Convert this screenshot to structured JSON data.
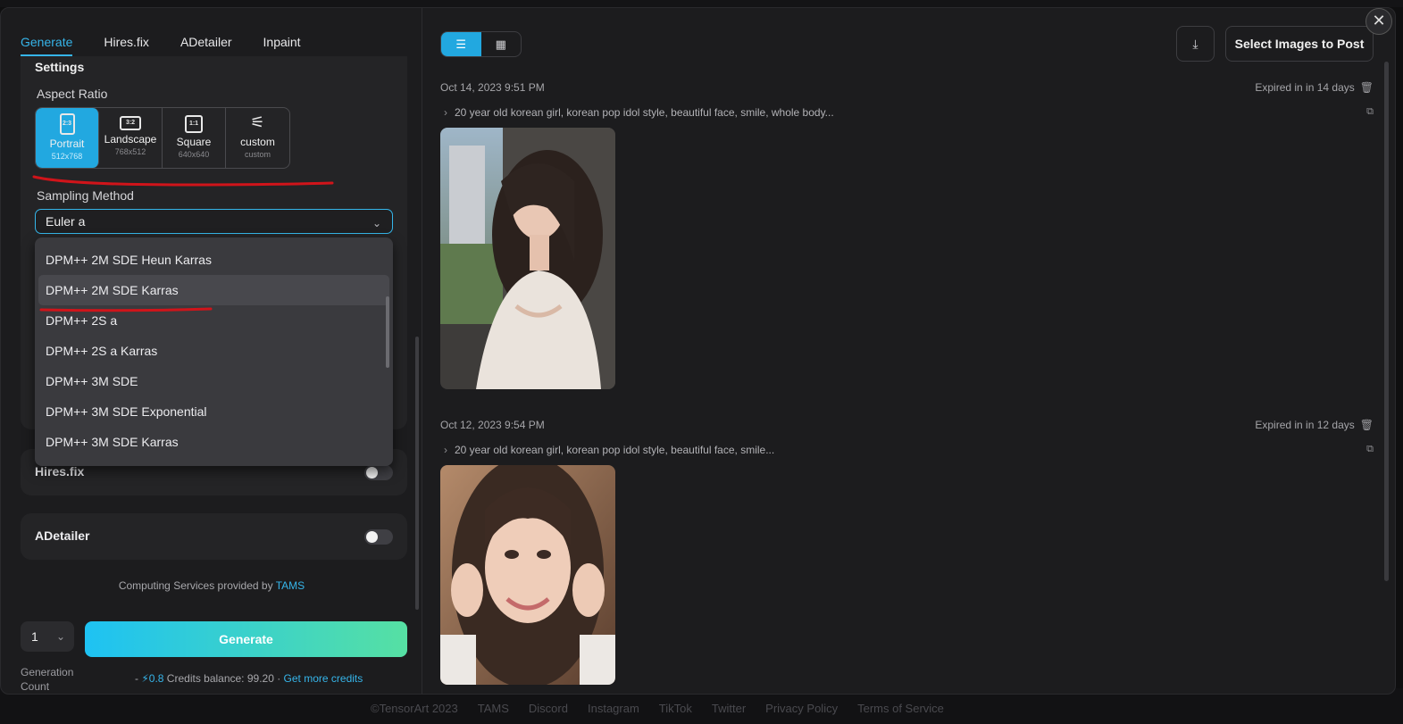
{
  "tabs": [
    {
      "label": "Generate"
    },
    {
      "label": "Hires.fix"
    },
    {
      "label": "ADetailer"
    },
    {
      "label": "Inpaint"
    }
  ],
  "settings": {
    "title": "Settings",
    "aspect_ratio_label": "Aspect Ratio",
    "ratios": [
      {
        "icon_text": "2:3",
        "name": "Portrait",
        "size": "512x768",
        "selected": true
      },
      {
        "icon_text": "3:2",
        "name": "Landscape",
        "size": "768x512",
        "selected": false
      },
      {
        "icon_text": "1:1",
        "name": "Square",
        "size": "640x640",
        "selected": false
      },
      {
        "icon_text": "⚟",
        "name": "custom",
        "size": "custom",
        "selected": false
      }
    ],
    "sampling_label": "Sampling Method",
    "sampling_value": "Euler a",
    "sampling_options": [
      "DPM++ 2M SDE Heun Karras",
      "DPM++ 2M SDE Karras",
      "DPM++ 2S a",
      "DPM++ 2S a Karras",
      "DPM++ 3M SDE",
      "DPM++ 3M SDE Exponential",
      "DPM++ 3M SDE Karras"
    ],
    "highlighted_option": "DPM++ 2M SDE Karras"
  },
  "hires": {
    "label": "Hires.fix",
    "enabled": false
  },
  "adetailer": {
    "label": "ADetailer",
    "enabled": false
  },
  "provider": {
    "text": "Computing Services provided by ",
    "link": "TAMS"
  },
  "generate": {
    "count": "1",
    "button_label": "Generate",
    "count_label": "Generation Count",
    "credits_prefix": "- ",
    "credits_cost": "0.8",
    "credits_balance": " Credits balance: 99.20 · ",
    "credits_link": "Get more credits"
  },
  "toolbar": {
    "select_post_label": "Select Images to Post"
  },
  "entries": [
    {
      "date": "Oct 14, 2023 9:51 PM",
      "expiry": "Expired in in 14 days",
      "prompt": "20 year old korean girl, korean pop idol style, beautiful face, smile, whole body..."
    },
    {
      "date": "Oct 12, 2023 9:54 PM",
      "expiry": "Expired in in 12 days",
      "prompt": "20 year old korean girl, korean pop idol style, beautiful face, smile..."
    }
  ],
  "footer": [
    "©TensorArt 2023",
    "TAMS",
    "Discord",
    "Instagram",
    "TikTok",
    "Twitter",
    "Privacy Policy",
    "Terms of Service"
  ],
  "colors": {
    "accent": "#22a8e0",
    "gradient_start": "#1ec2f3",
    "gradient_end": "#56e0a3",
    "annotation": "#d0141a"
  }
}
